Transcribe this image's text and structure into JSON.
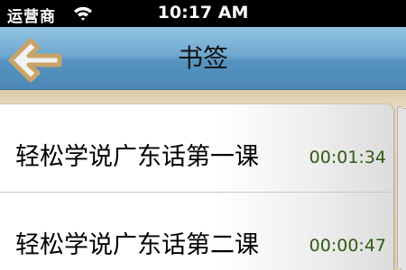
{
  "status_bar": {
    "carrier": "运营商",
    "time": "10:17 AM"
  },
  "nav": {
    "title": "书签",
    "back_icon": "back-arrow-icon"
  },
  "bookmarks": [
    {
      "title": "轻松学说广东话第一课",
      "time": "00:01:34"
    },
    {
      "title": "轻松学说广东话第二课",
      "time": "00:00:47"
    }
  ],
  "colors": {
    "nav_bar": "#6fa8cf",
    "time_text": "#2f5a12",
    "back_arrow": "#c9a468"
  }
}
